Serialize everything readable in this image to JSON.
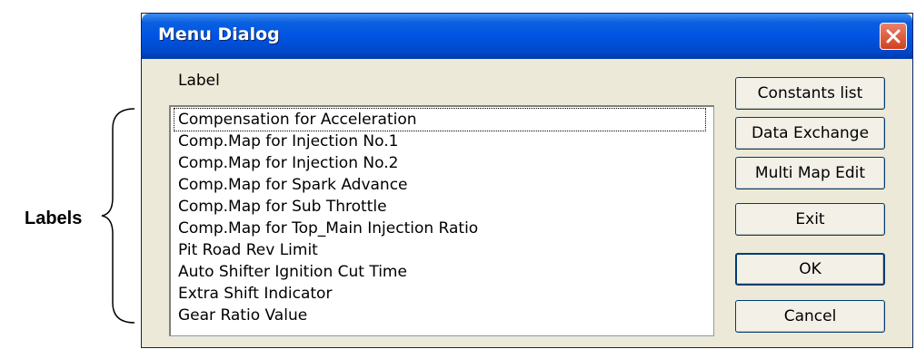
{
  "annotation": {
    "text": "Labels"
  },
  "window": {
    "title": "Menu Dialog",
    "section_label": "Label",
    "list_items": [
      "Compensation for Acceleration",
      "Comp.Map for Injection No.1",
      "Comp.Map for Injection No.2",
      "Comp.Map for Spark Advance",
      "Comp.Map for Sub Throttle",
      "Comp.Map for Top_Main Injection Ratio",
      "Pit Road Rev Limit",
      "Auto Shifter Ignition Cut Time",
      "Extra Shift Indicator",
      "Gear Ratio Value"
    ],
    "buttons": {
      "constants": "Constants list",
      "data_exchange": "Data Exchange",
      "multi_map": "Multi Map Edit",
      "exit": "Exit",
      "ok": "OK",
      "cancel": "Cancel"
    }
  }
}
